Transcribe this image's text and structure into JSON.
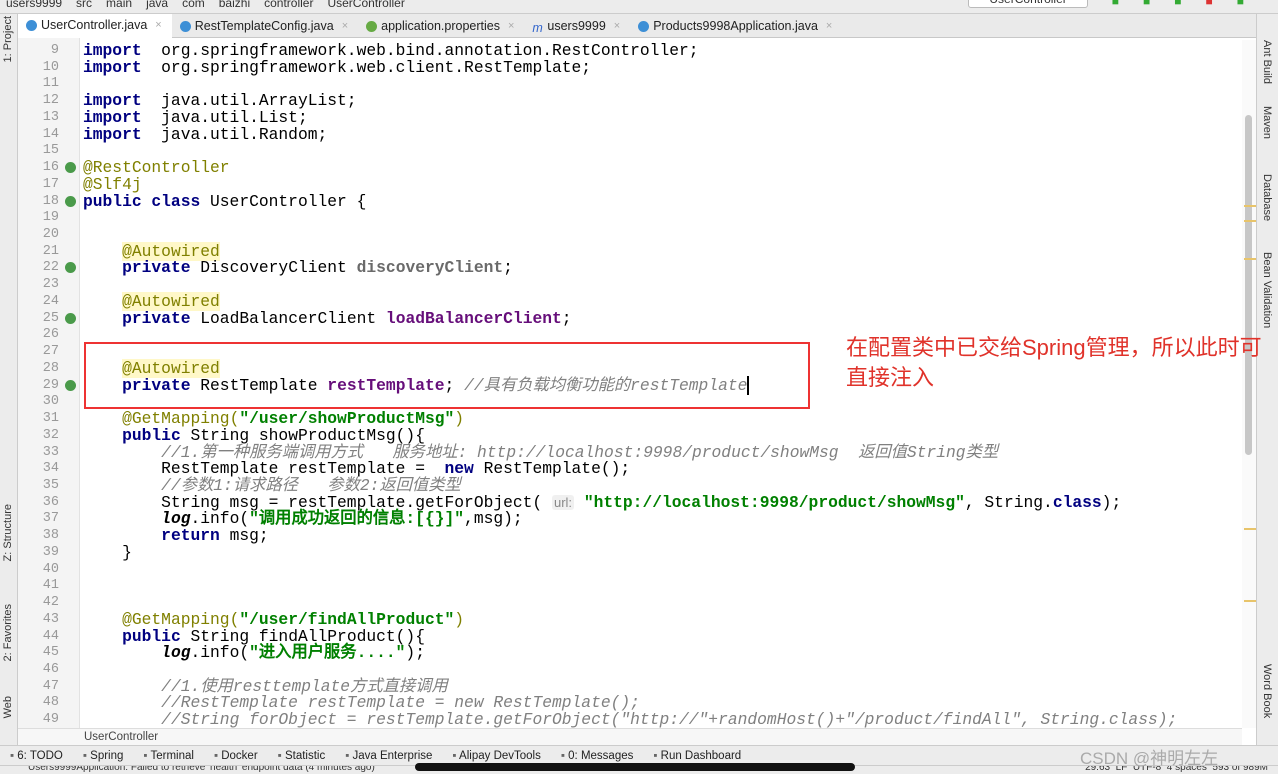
{
  "breadcrumb": [
    "users9999",
    "src",
    "main",
    "java",
    "com",
    "baizhi",
    "controller",
    "UserController"
  ],
  "run_config": "UserController",
  "tabs": [
    {
      "label": "UserController.java",
      "active": true,
      "icon": "java-class-icon"
    },
    {
      "label": "RestTemplateConfig.java",
      "active": false,
      "icon": "java-class-icon"
    },
    {
      "label": "application.properties",
      "active": false,
      "icon": "spring-properties-icon"
    },
    {
      "label": "users9999",
      "active": false,
      "icon": "maven-icon"
    },
    {
      "label": "Products9998Application.java",
      "active": false,
      "icon": "spring-boot-class-icon"
    }
  ],
  "left_panels": [
    "1: Project",
    "Z: Structure",
    "2: Favorites",
    "Web"
  ],
  "right_panels": [
    "Ant Build",
    "Maven",
    "Database",
    "Bean Validation",
    "Word Book"
  ],
  "code": {
    "first_line": 9,
    "lines": [
      [
        [
          "kw",
          "import"
        ],
        [
          "",
          "  org.springframework.web.bind.annotation.RestController;"
        ]
      ],
      [
        [
          "kw",
          "import"
        ],
        [
          "",
          "  org.springframework.web.client.RestTemplate;"
        ]
      ],
      [],
      [
        [
          "kw",
          "import"
        ],
        [
          "",
          "  java.util.ArrayList;"
        ]
      ],
      [
        [
          "kw",
          "import"
        ],
        [
          "",
          "  java.util.List;"
        ]
      ],
      [
        [
          "kw",
          "import"
        ],
        [
          "",
          "  java.util.Random;"
        ]
      ],
      [],
      [
        [
          "ann",
          "@RestController"
        ]
      ],
      [
        [
          "ann",
          "@Slf4j"
        ]
      ],
      [
        [
          "kw",
          "public class"
        ],
        [
          "",
          " UserController {"
        ]
      ],
      [],
      [],
      [
        [
          "",
          "    "
        ],
        [
          "annhl",
          "@Autowired"
        ]
      ],
      [
        [
          "",
          "    "
        ],
        [
          "kw",
          "private"
        ],
        [
          "",
          " DiscoveryClient "
        ],
        [
          "fldg",
          "discoveryClient"
        ],
        [
          "",
          ";"
        ]
      ],
      [],
      [
        [
          "",
          "    "
        ],
        [
          "annhl",
          "@Autowired"
        ]
      ],
      [
        [
          "",
          "    "
        ],
        [
          "kw",
          "private"
        ],
        [
          "",
          " LoadBalancerClient "
        ],
        [
          "fld",
          "loadBalancerClient"
        ],
        [
          "",
          ";"
        ]
      ],
      [],
      [],
      [
        [
          "",
          "    "
        ],
        [
          "annhl",
          "@Autowired"
        ]
      ],
      [
        [
          "",
          "    "
        ],
        [
          "kw",
          "private"
        ],
        [
          "",
          " RestTemplate "
        ],
        [
          "fld",
          "restTemplate"
        ],
        [
          "",
          "; "
        ],
        [
          "cm",
          "//具有负载均衡功能的restTemplate"
        ],
        [
          "caret",
          ""
        ]
      ],
      [],
      [
        [
          "",
          "    "
        ],
        [
          "ann",
          "@GetMapping("
        ],
        [
          "str",
          "\"/user/showProductMsg\""
        ],
        [
          "ann",
          ")"
        ]
      ],
      [
        [
          "",
          "    "
        ],
        [
          "kw",
          "public"
        ],
        [
          "",
          " String showProductMsg(){"
        ]
      ],
      [
        [
          "",
          "        "
        ],
        [
          "cm",
          "//1.第一种服务端调用方式   服务地址: http://localhost:9998/product/showMsg  返回值String类型"
        ]
      ],
      [
        [
          "",
          "        RestTemplate restTemplate =  "
        ],
        [
          "kw",
          "new"
        ],
        [
          "",
          " RestTemplate();"
        ]
      ],
      [
        [
          "",
          "        "
        ],
        [
          "cm",
          "//参数1:请求路径   参数2:返回值类型"
        ]
      ],
      [
        [
          "",
          "        String msg = restTemplate.getForObject( "
        ],
        [
          "hint",
          "url:"
        ],
        [
          "",
          " "
        ],
        [
          "str",
          "\"http://localhost:9998/product/showMsg\""
        ],
        [
          "",
          ", String."
        ],
        [
          "kw",
          "class"
        ],
        [
          "",
          ");"
        ]
      ],
      [
        [
          "",
          "        "
        ],
        [
          "st",
          "log"
        ],
        [
          "",
          ".info("
        ],
        [
          "str",
          "\"调用成功返回的信息:[{}]\""
        ],
        [
          "",
          ",msg);"
        ]
      ],
      [
        [
          "",
          "        "
        ],
        [
          "kw",
          "return"
        ],
        [
          "",
          " msg;"
        ]
      ],
      [
        [
          "",
          "    }"
        ]
      ],
      [],
      [],
      [],
      [
        [
          "",
          "    "
        ],
        [
          "ann",
          "@GetMapping("
        ],
        [
          "str",
          "\"/user/findAllProduct\""
        ],
        [
          "ann",
          ")"
        ]
      ],
      [
        [
          "",
          "    "
        ],
        [
          "kw",
          "public"
        ],
        [
          "",
          " String findAllProduct(){"
        ]
      ],
      [
        [
          "",
          "        "
        ],
        [
          "st",
          "log"
        ],
        [
          "",
          ".info("
        ],
        [
          "str",
          "\"进入用户服务....\""
        ],
        [
          "",
          ");"
        ]
      ],
      [],
      [
        [
          "",
          "        "
        ],
        [
          "cm",
          "//1.使用resttemplate方式直接调用"
        ]
      ],
      [
        [
          "",
          "        "
        ],
        [
          "cm",
          "//RestTemplate restTemplate = new RestTemplate();"
        ]
      ],
      [
        [
          "",
          "        "
        ],
        [
          "cm",
          "//String forObject = restTemplate.getForObject(\"http://\"+randomHost()+\"/product/findAll\", String.class);"
        ]
      ]
    ],
    "gutter_icons": {
      "16": "spring-bean-icon",
      "18": "spring-bean-icon",
      "22": "spring-bean-icon",
      "25": "spring-bean-icon",
      "29": "spring-bean-icon"
    }
  },
  "annotation_note": "在配置类中已交给Spring管理，所以此时可直接注入",
  "code_breadcrumb": "UserController",
  "tool_windows": [
    "6: TODO",
    "Spring",
    "Terminal",
    "Docker",
    "Statistic",
    "Java Enterprise",
    "Alipay DevTools",
    "0: Messages",
    "Run Dashboard"
  ],
  "status": {
    "message": "Users9999Application: Failed to retrieve 'health' endpoint data (4 minutes ago)",
    "position": "29:63",
    "line_sep": "LF",
    "encoding": "UTF-8",
    "indent": "4 spaces",
    "memory": "593 of 989M"
  },
  "watermark": "CSDN @神明左左",
  "colors": {
    "keyword": "#000080",
    "annotation": "#808000",
    "string": "#008000",
    "comment": "#808080",
    "field": "#660e7a",
    "note_red": "#e0322a"
  }
}
